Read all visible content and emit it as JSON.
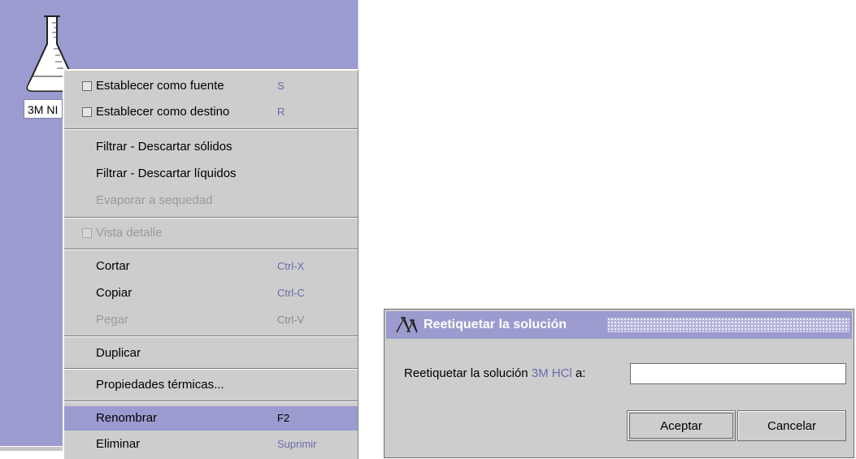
{
  "workspace": {
    "solution_label": "3M NI"
  },
  "context_menu": {
    "items": [
      {
        "label": "Establecer como fuente",
        "accelerator": "S",
        "checkbox": true,
        "enabled": true
      },
      {
        "label": "Establecer como destino",
        "accelerator": "R",
        "checkbox": true,
        "enabled": true
      },
      {
        "label": "Filtrar - Descartar sólidos",
        "accelerator": "",
        "enabled": true
      },
      {
        "label": "Filtrar - Descartar líquidos",
        "accelerator": "",
        "enabled": true
      },
      {
        "label": "Evaporar a sequedad",
        "accelerator": "",
        "enabled": false
      },
      {
        "label": "Vista detalle",
        "accelerator": "",
        "checkbox": true,
        "enabled": false
      },
      {
        "label": "Cortar",
        "accelerator": "Ctrl-X",
        "enabled": true
      },
      {
        "label": "Copiar",
        "accelerator": "Ctrl-C",
        "enabled": true
      },
      {
        "label": "Pegar",
        "accelerator": "Ctrl-V",
        "enabled": false
      },
      {
        "label": "Duplicar",
        "accelerator": "",
        "enabled": true
      },
      {
        "label": "Propiedades térmicas...",
        "accelerator": "",
        "enabled": true
      },
      {
        "label": "Renombrar",
        "accelerator": "F2",
        "enabled": true,
        "selected": true
      },
      {
        "label": "Eliminar",
        "accelerator": "Suprimir",
        "enabled": true
      }
    ]
  },
  "dialog": {
    "title": "Reetiquetar la solución",
    "prompt_prefix": "Reetiquetar la solución",
    "solution_name": "3M HCl",
    "prompt_suffix": "a:",
    "input_value": "",
    "ok_label": "Aceptar",
    "cancel_label": "Cancelar"
  },
  "colors": {
    "accent": "#9b9bd0",
    "menu_bg": "#cdcdcd",
    "accelerator_text": "#6b6bae"
  }
}
